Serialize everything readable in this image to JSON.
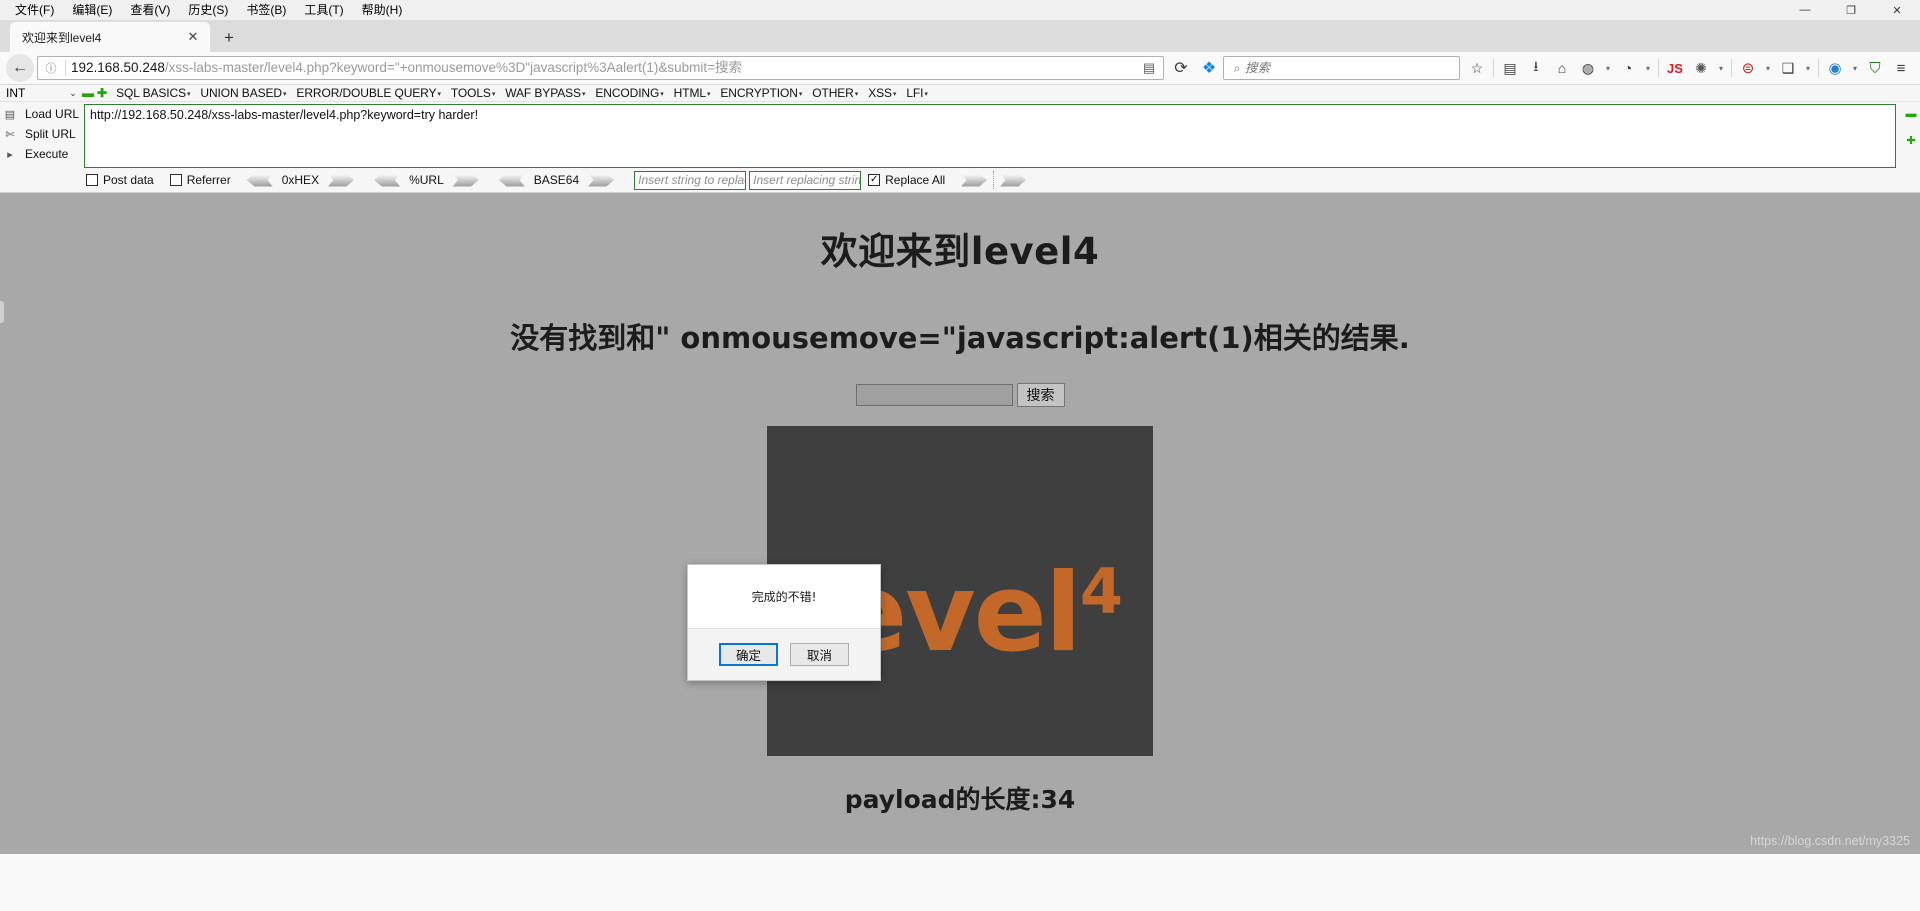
{
  "window": {
    "menus": [
      "文件(F)",
      "编辑(E)",
      "查看(V)",
      "历史(S)",
      "书签(B)",
      "工具(T)",
      "帮助(H)"
    ],
    "controls": {
      "minimize": "—",
      "maximize": "❐",
      "close": "✕"
    }
  },
  "tabs": {
    "items": [
      {
        "title": "欢迎来到level4",
        "close": "✕"
      }
    ],
    "new_tab": "+"
  },
  "navbar": {
    "back": "←",
    "identity_icon": "ⓘ",
    "url_host": "192.168.50.248",
    "url_path": "/xss-labs-master/level4.php?keyword=\"+onmousemove%3D\"javascript%3Aalert(1)&submit=搜索",
    "reader_icon": "▤",
    "reload_icon": "⟳",
    "pocket_icon": "❖",
    "search_placeholder": "搜索",
    "search_icon": "⌕",
    "star_icon": "☆",
    "library_icon": "▤",
    "download_icon": "⭳",
    "home_icon": "⌂",
    "account_icon": "◍",
    "cookie_icon": "◔",
    "chevron": "▾",
    "js_badge": "JS",
    "spider_icon": "✺",
    "hackbar_icon": "⊜",
    "page_icon": "❑",
    "proxy_icon": "◉",
    "shield_icon": "⛉",
    "menu_icon": "≡"
  },
  "hackbar": {
    "type_value": "INT",
    "type_caret": "⌄",
    "minus_icon": "▬",
    "plus_icon": "✚",
    "menus": [
      "SQL BASICS",
      "UNION BASED",
      "ERROR/DOUBLE QUERY",
      "TOOLS",
      "WAF BYPASS",
      "ENCODING",
      "HTML",
      "ENCRYPTION",
      "OTHER",
      "XSS",
      "LFI"
    ],
    "menu_arrow": "▾",
    "actions": [
      {
        "label": "Load URL",
        "icon": "load-url-icon",
        "glyph": "▤"
      },
      {
        "label": "Split URL",
        "icon": "scissors-icon",
        "glyph": "✄"
      },
      {
        "label": "Execute",
        "icon": "play-icon",
        "glyph": "▸"
      }
    ],
    "url_value": "http://192.168.50.248/xss-labs-master/level4.php?keyword=try harder!",
    "rail_icons": [
      "▬",
      "✚"
    ],
    "options": {
      "post_data": {
        "label": "Post data",
        "checked": false
      },
      "referrer": {
        "label": "Referrer",
        "checked": false
      },
      "encoders": [
        "0xHEX",
        "%URL",
        "BASE64"
      ],
      "replace_find_placeholder": "Insert string to replace",
      "replace_with_placeholder": "Insert replacing string",
      "replace_all": {
        "label": "Replace All",
        "checked": true,
        "mark": "✓"
      }
    }
  },
  "page": {
    "heading": "欢迎来到level4",
    "message": "没有找到和\" onmousemove=\"javascript:alert(1)相关的结果.",
    "search_input_value": "",
    "search_button": "搜索",
    "image_word": "level",
    "image_sup": "4",
    "payload_length": "payload的长度:34"
  },
  "dialog": {
    "message": "完成的不错!",
    "ok_label": "确定",
    "cancel_label": "取消"
  },
  "watermark": "https://blog.csdn.net/my3325",
  "colors": {
    "page_bg": "#a8a8a8",
    "image_bg": "#3f3f3f",
    "brand_orange": "#c4682a",
    "hackbar_green": "#2e7d32",
    "focus_blue": "#0a76d4"
  }
}
